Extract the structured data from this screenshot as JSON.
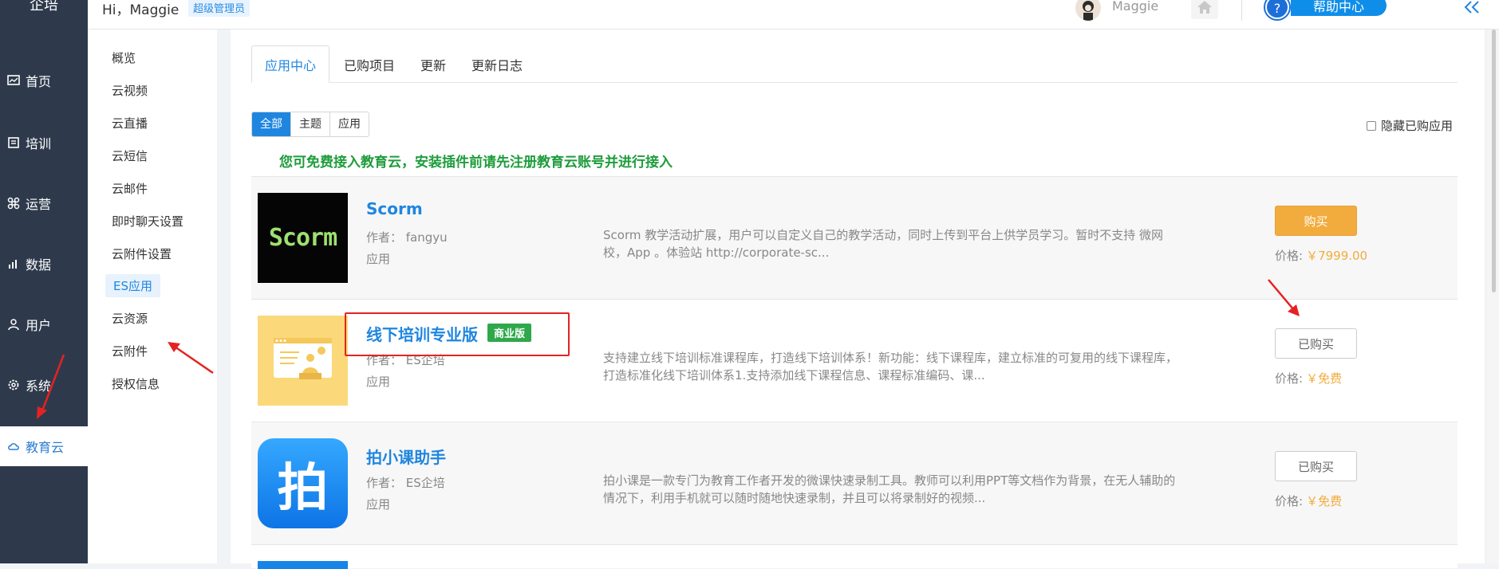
{
  "sidebar": {
    "brand": "企培",
    "items": [
      {
        "label": "首页",
        "icon": "dashboard-icon"
      },
      {
        "label": "培训",
        "icon": "book-icon"
      },
      {
        "label": "运营",
        "icon": "command-icon"
      },
      {
        "label": "数据",
        "icon": "chart-icon"
      },
      {
        "label": "用户",
        "icon": "user-icon"
      },
      {
        "label": "系统",
        "icon": "gear-icon"
      },
      {
        "label": "教育云",
        "icon": "cloud-icon",
        "active": true
      }
    ]
  },
  "header": {
    "greeting": "Hi，Maggie",
    "role_badge": "超级管理员",
    "username": "Maggie",
    "help_q": "?",
    "help_label": "帮助中心"
  },
  "submenu": {
    "items": [
      "概览",
      "云视频",
      "云直播",
      "云短信",
      "云邮件",
      "即时聊天设置",
      "云附件设置",
      "ES应用",
      "云资源",
      "云附件",
      "授权信息"
    ],
    "active": "ES应用"
  },
  "tabs": [
    "应用中心",
    "已购项目",
    "更新",
    "更新日志"
  ],
  "filters": [
    "全部",
    "主题",
    "应用"
  ],
  "hide_owned_label": "隐藏已购应用",
  "notice": "您可免费接入教育云，安装插件前请先注册教育云账号并进行接入",
  "price_label": "价格:",
  "apps": [
    {
      "title": "Scorm",
      "thumb_text": "Scorm",
      "author": "作者： fangyu",
      "kind": "应用",
      "desc": "Scorm 教学活动扩展，用户可以自定义自己的教学活动，同时上传到平台上供学员学习。暂时不支持 微网校，App 。体验站 http://corporate-sc...",
      "button": "购买",
      "price": "￥7999.00"
    },
    {
      "title": "线下培训专业版",
      "tag": "商业版",
      "author": "作者： ES企培",
      "kind": "应用",
      "desc": "支持建立线下培训标准课程库，打造线下培训体系！新功能：线下课程库，建立标准的可复用的线下课程库，打造标准化线下培训体系1.支持添加线下课程信息、课程标准编码、课...",
      "button": "已购买",
      "price": "￥免费"
    },
    {
      "title": "拍小课助手",
      "thumb_text": "拍",
      "author": "作者： ES企培",
      "kind": "应用",
      "desc": "拍小课是一款专门为教育工作者开发的微课快速录制工具。教师可以利用PPT等文档作为背景，在无人辅助的情况下，利用手机就可以随时随地快速录制，并且可以将录制好的视频...",
      "button": "已购买",
      "price": "￥免费"
    }
  ],
  "colors": {
    "sidebar_bg": "#2e3a4c",
    "primary": "#1f86e0",
    "notice_green": "#1e9c3c",
    "buy_orange": "#f1ac3d",
    "annotation_red": "#e52222"
  }
}
